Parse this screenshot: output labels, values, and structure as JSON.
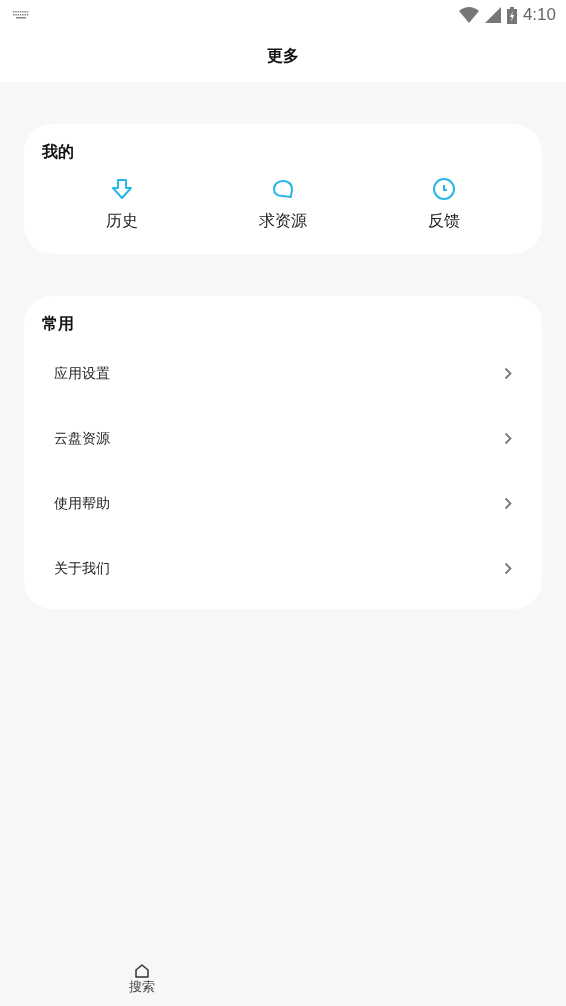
{
  "status_bar": {
    "time": "4:10"
  },
  "header": {
    "title": "更多"
  },
  "mine": {
    "title": "我的",
    "items": [
      {
        "label": "历史",
        "kind": "download"
      },
      {
        "label": "求资源",
        "kind": "bubble"
      },
      {
        "label": "反馈",
        "kind": "clock"
      }
    ]
  },
  "common": {
    "title": "常用",
    "items": [
      {
        "label": "应用设置"
      },
      {
        "label": "云盘资源"
      },
      {
        "label": "使用帮助"
      },
      {
        "label": "关于我们"
      }
    ]
  },
  "tab_bar": [
    {
      "label": "搜索",
      "kind": "home"
    }
  ]
}
